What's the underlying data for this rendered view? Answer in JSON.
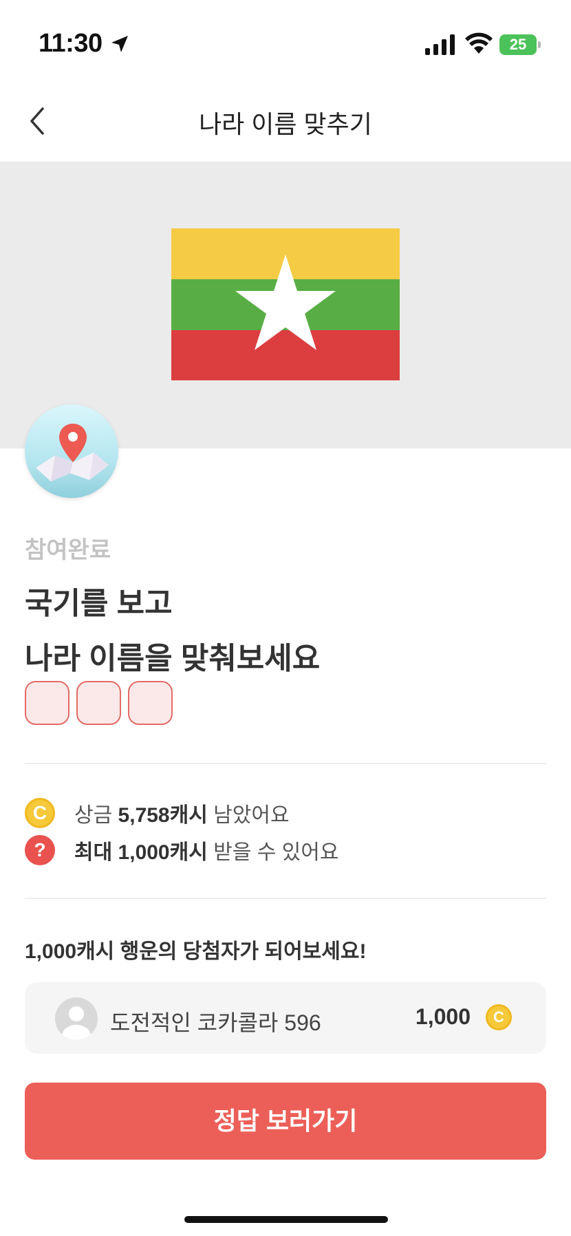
{
  "status_bar": {
    "time": "11:30",
    "battery_level": "25"
  },
  "nav": {
    "title": "나라 이름 맞추기"
  },
  "flag": {
    "colors": [
      "#f5cb45",
      "#58ae45",
      "#dc3e40"
    ],
    "star_color": "#ffffff"
  },
  "quiz": {
    "status_label": "참여완료",
    "question_line1": "국기를 보고",
    "question_line2": "나라 이름을 맞춰보세요",
    "answer_slot_count": 3
  },
  "info": {
    "prize_prefix": "상금 ",
    "prize_amount": "5,758캐시",
    "prize_suffix": " 남았어요",
    "max_prefix": "최대 ",
    "max_amount": "1,000캐시",
    "max_suffix": " 받을 수 있어요",
    "coin_symbol": "C",
    "help_symbol": "?"
  },
  "lucky": {
    "title": "1,000캐시 행운의 당첨자가 되어보세요!",
    "winner_name": "도전적인 코카콜라 596",
    "winner_amount": "1,000"
  },
  "cta": {
    "label": "정답 보러가기"
  },
  "colors": {
    "accent": "#ec5f58",
    "coin": "#f6c93a",
    "slot_border": "#e46a66",
    "slot_fill": "#fbe9e9"
  }
}
